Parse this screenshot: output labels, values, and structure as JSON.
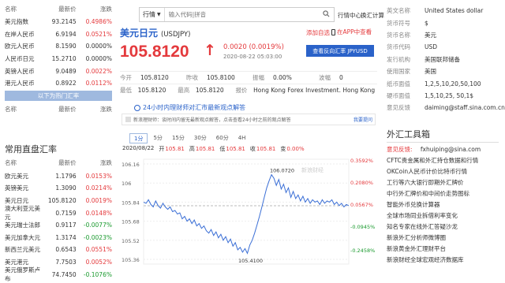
{
  "left": {
    "top_header": {
      "name": "名称",
      "price": "最新价",
      "change": "涨跌"
    },
    "top_rows": [
      {
        "name": "美元指数",
        "price": "93.2145",
        "change": "0.4986%",
        "dir": "up"
      },
      {
        "name": "在岸人民币",
        "price": "6.9194",
        "change": "0.0521%",
        "dir": "up"
      },
      {
        "name": "欧元人民币",
        "price": "8.1590",
        "change": "0.0000%",
        "dir": "flat"
      },
      {
        "name": "人民币日元",
        "price": "15.2710",
        "change": "0.0000%",
        "dir": "flat"
      },
      {
        "name": "英镑人民币",
        "price": "9.0489",
        "change": "0.0022%",
        "dir": "up"
      },
      {
        "name": "港元人民币",
        "price": "0.8922",
        "change": "0.0112%",
        "dir": "up"
      }
    ],
    "blue_bar": "以下为热门汇率",
    "sub_header": {
      "name": "名称",
      "price": "最新价",
      "change": "涨跌"
    },
    "direct_title": "常用直盘汇率",
    "direct_header": {
      "name": "名称",
      "price": "最新价",
      "change": "涨跌"
    },
    "direct_rows": [
      {
        "name": "欧元美元",
        "price": "1.1796",
        "change": "0.0153%",
        "dir": "up"
      },
      {
        "name": "英镑美元",
        "price": "1.3090",
        "change": "0.0214%",
        "dir": "up"
      },
      {
        "name": "美元日元",
        "price": "105.8120",
        "change": "0.0019%",
        "dir": "up"
      },
      {
        "name": "澳大利亚元美元",
        "price": "0.7159",
        "change": "0.0148%",
        "dir": "up"
      },
      {
        "name": "美元瑞士法郎",
        "price": "0.9117",
        "change": "-0.0077%",
        "dir": "down"
      },
      {
        "name": "美元加拿大元",
        "price": "1.3174",
        "change": "-0.0023%",
        "dir": "down"
      },
      {
        "name": "新西兰元美元",
        "price": "0.6543",
        "change": "0.0551%",
        "dir": "up"
      },
      {
        "name": "美元港元",
        "price": "7.7503",
        "change": "0.0052%",
        "dir": "up"
      },
      {
        "name": "美元俄罗斯卢布",
        "price": "74.7450",
        "change": "-0.1076%",
        "dir": "down"
      }
    ]
  },
  "search": {
    "select": "行情",
    "placeholder": "输入代码|拼音",
    "links": [
      "行情中心",
      "换汇计算"
    ]
  },
  "quote": {
    "title": "美元日元",
    "code": "(USDJPY)",
    "add_watch": "添加自选",
    "app_link": "在APP中查看",
    "price": "105.8120",
    "arrow": "↑",
    "change": "0.0020 (0.0019%)",
    "time": "2020-08-22 05:03:00",
    "reverse_button": "查看反向汇率 JPYUSD",
    "stats_row1": [
      {
        "k": "今开",
        "v": "105.8120"
      },
      {
        "k": "昨收",
        "v": "105.8100"
      },
      {
        "k": "振幅",
        "v": "0.00%"
      },
      {
        "k": "波幅",
        "v": "0"
      }
    ],
    "stats_row2": [
      {
        "k": "最低",
        "v": "105.8120"
      },
      {
        "k": "最高",
        "v": "105.8120"
      },
      {
        "k": "报价",
        "v": "Hong Kong Forex Investment. Hong Kong"
      }
    ]
  },
  "news": {
    "headline": "24小时内理财师对汇市最新观点解答",
    "sub": "新浪理财师：谈时间内留无最新观点解答，点击查看24小时之前的观点解答",
    "feedback": "我要提问"
  },
  "tabs": [
    "1分",
    "5分",
    "15分",
    "30分",
    "60分",
    "4H"
  ],
  "active_tab": "1分",
  "chart_legend": {
    "date": "2020/08/22",
    "items": [
      {
        "k": "开",
        "v": "105.81"
      },
      {
        "k": "高",
        "v": "105.81"
      },
      {
        "k": "低",
        "v": "105.81"
      },
      {
        "k": "收",
        "v": "105.81"
      },
      {
        "k": "变",
        "v": "0.00%"
      }
    ]
  },
  "chart_data": {
    "type": "line",
    "y_ticks": [
      "106.16",
      "106",
      "105.84",
      "105.68",
      "105.52",
      "105.36"
    ],
    "pct_ticks": [
      "0.3592%",
      "0.2080%",
      "0.0567%",
      "-0.0945%",
      "-0.2458%"
    ],
    "ylim": [
      105.32,
      106.2
    ],
    "max_label": "106.0720",
    "min_label": "105.4100",
    "watermark": "新浪财经",
    "values": [
      105.84,
      105.83,
      105.86,
      105.82,
      105.8,
      105.85,
      105.81,
      105.79,
      105.83,
      105.8,
      105.78,
      105.8,
      105.76,
      105.77,
      105.74,
      105.75,
      105.7,
      105.72,
      105.68,
      105.7,
      105.66,
      105.69,
      105.64,
      105.66,
      105.62,
      105.64,
      105.6,
      105.58,
      105.61,
      105.56,
      105.59,
      105.54,
      105.57,
      105.52,
      105.55,
      105.5,
      105.53,
      105.47,
      105.5,
      105.44,
      105.46,
      105.42,
      105.45,
      105.41,
      105.48,
      105.52,
      105.58,
      105.65,
      105.72,
      105.8,
      105.88,
      105.96,
      106.02,
      106.07,
      106.04,
      105.98,
      106.03,
      105.95,
      105.99,
      105.92,
      105.96,
      105.88,
      105.93,
      105.87,
      105.9,
      105.85,
      105.89,
      105.84,
      105.87,
      105.83,
      105.86,
      105.84,
      105.85,
      105.82,
      105.86,
      105.83,
      105.85,
      105.84,
      105.86,
      105.82,
      105.84,
      105.81,
      105.83,
      105.8,
      105.82,
      105.81
    ]
  },
  "right": {
    "info": [
      {
        "k": "英文名称",
        "v": "United States dollar"
      },
      {
        "k": "货币符号",
        "v": "$"
      },
      {
        "k": "货币名称",
        "v": "美元"
      },
      {
        "k": "货币代码",
        "v": "USD"
      },
      {
        "k": "发行机构",
        "v": "美国联邦储备"
      },
      {
        "k": "使用国家",
        "v": "美国"
      },
      {
        "k": "纸币面值",
        "v": "1,2,5,10,20,50,100"
      },
      {
        "k": "硬币面值",
        "v": "1,5,10,25, 50,1$"
      },
      {
        "k": "意见反馈",
        "v": "daiming@staff.sina.com.cn"
      }
    ],
    "tools_title": "外汇工具箱",
    "feedback_line": {
      "k": "意见反馈:",
      "v": "fxhuiping@sina.com"
    },
    "tools": [
      "CFTC贵金属和外汇持仓数据和行情",
      "OKCoin人民币计价比特币行情",
      "工行等六大银行即期外汇牌价",
      "中行外汇牌价和中间价走势图标",
      "智能外币兑换计算器",
      "全球市场同业拆借利率变化",
      "知名专家在线外汇答疑沙龙",
      "新浪外汇分析师微博圈",
      "新浪黄金外汇理财平台",
      "新浪财经全球宏观经济数据库"
    ]
  },
  "colors": {
    "up": "#e4393c",
    "down": "#1a9a2e",
    "flat": "#333333",
    "accent": "#2a62c9",
    "bar": "#9fb9df",
    "line": "#3b6fd6"
  }
}
